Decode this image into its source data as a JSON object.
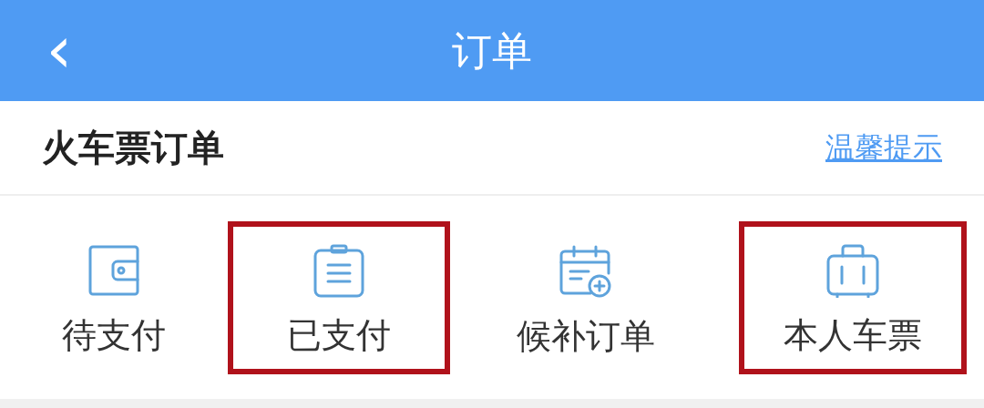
{
  "header": {
    "back_icon": "‹",
    "title": "订单"
  },
  "section": {
    "title": "火车票订单",
    "link": "温馨提示"
  },
  "items": [
    {
      "kind": "wallet",
      "label": "待支付",
      "highlighted": false
    },
    {
      "kind": "clipboard",
      "label": "已支付",
      "highlighted": true
    },
    {
      "kind": "calendar",
      "label": "候补订单",
      "highlighted": false
    },
    {
      "kind": "suitcase",
      "label": "本人车票",
      "highlighted": true
    }
  ]
}
